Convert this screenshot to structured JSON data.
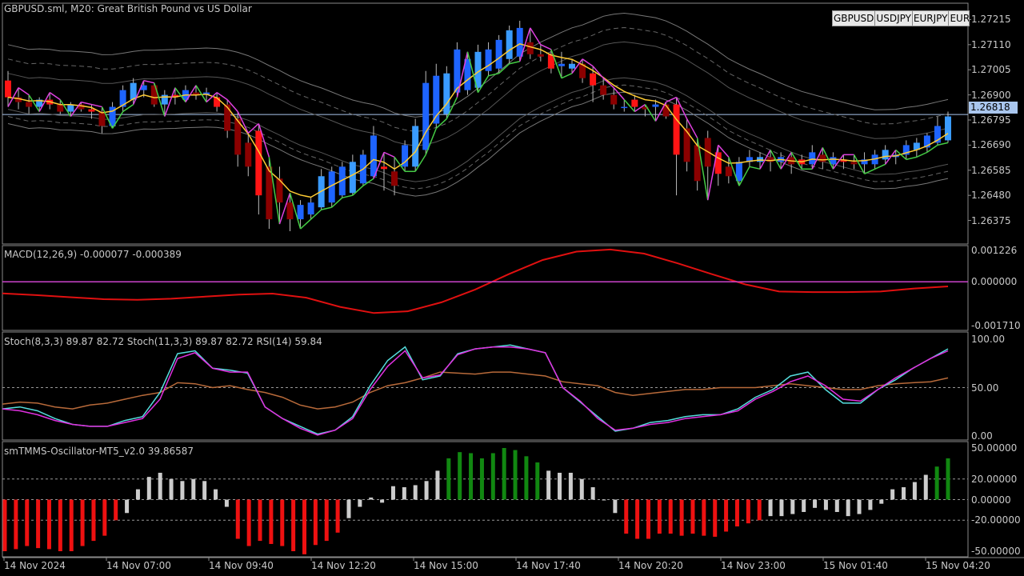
{
  "title": "GBPUSD.sml, M20:  Great British Pound vs US Dollar",
  "symbol_tabs": [
    "GBPUSD",
    "USDJPY",
    "EURJPY",
    "EUR"
  ],
  "current_price": "1.26818",
  "colors": {
    "background": "#000000",
    "bull_candle": "#1e64ff",
    "bull_candle_light": "#3a9bff",
    "bear_candle": "#8b0000",
    "bear_candle_bright": "#ff1414",
    "ma_yellow": "#ffcc33",
    "trail_green": "#44cc44",
    "trail_magenta": "#e040e0",
    "macd_line": "#e01010",
    "macd_signal": "#cc44cc",
    "stoch_cyan": "#55dddd",
    "stoch_magenta": "#e030e0",
    "rsi_brown": "#b86a3a",
    "osc_red": "#ee1111",
    "osc_gray": "#cccccc",
    "osc_green": "#118811"
  },
  "price_axis_labels": [
    "1.27215",
    "1.27110",
    "1.27005",
    "1.26900",
    "1.26795",
    "1.26690",
    "1.26585",
    "1.26480",
    "1.26375"
  ],
  "macd": {
    "label": "MACD(12,26,9) -0.000077 -0.000389",
    "axis_labels": [
      "0.001226",
      "0.000000",
      "-0.001710"
    ]
  },
  "stoch": {
    "label": "Stoch(8,3,3) 89.87 82.72 Stoch(11,3,3) 89.87 82.72 RSI(14) 59.84",
    "axis_labels": [
      "100.00",
      "50.00",
      "0.00"
    ]
  },
  "oscillator": {
    "label": "smTMMS-Oscillator-MT5_v2.0 39.86587",
    "axis_labels": [
      "50.00000",
      "20.00000",
      "0.00000",
      "-20.00000",
      "-50.00000"
    ]
  },
  "time_labels": [
    "14 Nov 2024",
    "14 Nov 07:00",
    "14 Nov 09:40",
    "14 Nov 12:20",
    "14 Nov 15:00",
    "14 Nov 17:40",
    "14 Nov 20:20",
    "14 Nov 23:00",
    "15 Nov 01:40",
    "15 Nov 04:20"
  ],
  "chart_data": {
    "type": "candlestick",
    "price_range": [
      1.263,
      1.2727
    ],
    "candles": [
      [
        1.2696,
        1.27,
        1.2685,
        1.2689
      ],
      [
        1.2689,
        1.2693,
        1.2684,
        1.2687
      ],
      [
        1.2687,
        1.269,
        1.2682,
        1.2685
      ],
      [
        1.2685,
        1.2689,
        1.2683,
        1.2688
      ],
      [
        1.2688,
        1.2691,
        1.2684,
        1.2686
      ],
      [
        1.2686,
        1.2688,
        1.2682,
        1.2683
      ],
      [
        1.2683,
        1.2687,
        1.2681,
        1.2686
      ],
      [
        1.2686,
        1.2687,
        1.2683,
        1.2684
      ],
      [
        1.2684,
        1.2686,
        1.268,
        1.2683
      ],
      [
        1.2683,
        1.2685,
        1.2674,
        1.2677
      ],
      [
        1.2677,
        1.2687,
        1.2676,
        1.2685
      ],
      [
        1.2685,
        1.2694,
        1.2683,
        1.2692
      ],
      [
        1.2688,
        1.2697,
        1.2686,
        1.2695
      ],
      [
        1.2692,
        1.2696,
        1.2689,
        1.2694
      ],
      [
        1.2694,
        1.2695,
        1.2685,
        1.2686
      ],
      [
        1.2686,
        1.2692,
        1.2681,
        1.269
      ],
      [
        1.269,
        1.2693,
        1.2686,
        1.2689
      ],
      [
        1.2688,
        1.2694,
        1.2687,
        1.2692
      ],
      [
        1.2691,
        1.2694,
        1.2688,
        1.269
      ],
      [
        1.269,
        1.2693,
        1.2687,
        1.2691
      ],
      [
        1.2689,
        1.2691,
        1.2683,
        1.2685
      ],
      [
        1.2686,
        1.2688,
        1.2672,
        1.2675
      ],
      [
        1.268,
        1.2683,
        1.266,
        1.2665
      ],
      [
        1.267,
        1.2674,
        1.2656,
        1.266
      ],
      [
        1.2675,
        1.2678,
        1.264,
        1.2648
      ],
      [
        1.266,
        1.2664,
        1.2634,
        1.2638
      ],
      [
        1.2655,
        1.266,
        1.2636,
        1.2645
      ],
      [
        1.2645,
        1.2649,
        1.2633,
        1.2638
      ],
      [
        1.2638,
        1.2646,
        1.2634,
        1.2644
      ],
      [
        1.264,
        1.2647,
        1.2638,
        1.2645
      ],
      [
        1.2643,
        1.2659,
        1.2642,
        1.2656
      ],
      [
        1.2645,
        1.266,
        1.2643,
        1.2658
      ],
      [
        1.2648,
        1.2662,
        1.2647,
        1.266
      ],
      [
        1.2649,
        1.2665,
        1.2648,
        1.2662
      ],
      [
        1.2653,
        1.2667,
        1.2652,
        1.2665
      ],
      [
        1.2656,
        1.2677,
        1.2655,
        1.2673
      ],
      [
        1.266,
        1.2666,
        1.265,
        1.2659
      ],
      [
        1.2658,
        1.2664,
        1.2648,
        1.2652
      ],
      [
        1.266,
        1.2671,
        1.2658,
        1.2669
      ],
      [
        1.266,
        1.268,
        1.2658,
        1.2677
      ],
      [
        1.2667,
        1.27,
        1.2665,
        1.2695
      ],
      [
        1.2678,
        1.2703,
        1.2676,
        1.2698
      ],
      [
        1.2682,
        1.2702,
        1.268,
        1.2699
      ],
      [
        1.2691,
        1.2712,
        1.2689,
        1.2709
      ],
      [
        1.2692,
        1.2708,
        1.269,
        1.2705
      ],
      [
        1.2693,
        1.2711,
        1.2691,
        1.2708
      ],
      [
        1.27,
        1.2712,
        1.2698,
        1.2709
      ],
      [
        1.2701,
        1.2715,
        1.2699,
        1.2713
      ],
      [
        1.2705,
        1.2719,
        1.2703,
        1.2717
      ],
      [
        1.2706,
        1.2721,
        1.2704,
        1.2718
      ],
      [
        1.2712,
        1.2718,
        1.2705,
        1.2707
      ],
      [
        1.2707,
        1.2711,
        1.2704,
        1.2706
      ],
      [
        1.2707,
        1.2709,
        1.2699,
        1.2701
      ],
      [
        1.2702,
        1.2708,
        1.2697,
        1.2703
      ],
      [
        1.2701,
        1.2705,
        1.2699,
        1.2703
      ],
      [
        1.2703,
        1.2705,
        1.2695,
        1.2697
      ],
      [
        1.2699,
        1.2702,
        1.2687,
        1.2694
      ],
      [
        1.2694,
        1.2697,
        1.2688,
        1.269
      ],
      [
        1.269,
        1.2693,
        1.2684,
        1.2686
      ],
      [
        1.2685,
        1.2688,
        1.2683,
        1.2685
      ],
      [
        1.2688,
        1.269,
        1.2683,
        1.2685
      ],
      [
        1.2685,
        1.2686,
        1.2681,
        1.2684
      ],
      [
        1.2685,
        1.2688,
        1.2679,
        1.2686
      ],
      [
        1.2686,
        1.2687,
        1.268,
        1.2681
      ],
      [
        1.2686,
        1.2689,
        1.2648,
        1.2665
      ],
      [
        1.2676,
        1.268,
        1.2658,
        1.2662
      ],
      [
        1.2669,
        1.2672,
        1.265,
        1.2654
      ],
      [
        1.2672,
        1.2675,
        1.2646,
        1.266
      ],
      [
        1.2666,
        1.2669,
        1.2652,
        1.2657
      ],
      [
        1.266,
        1.2664,
        1.2653,
        1.2656
      ],
      [
        1.2654,
        1.2664,
        1.2652,
        1.2662
      ],
      [
        1.2662,
        1.2667,
        1.266,
        1.2664
      ],
      [
        1.2662,
        1.2666,
        1.2659,
        1.2664
      ],
      [
        1.2664,
        1.2667,
        1.2658,
        1.2662
      ],
      [
        1.2662,
        1.2666,
        1.2659,
        1.2664
      ],
      [
        1.2664,
        1.2666,
        1.2657,
        1.2661
      ],
      [
        1.2663,
        1.2665,
        1.2659,
        1.2661
      ],
      [
        1.2661,
        1.2669,
        1.2659,
        1.2666
      ],
      [
        1.2665,
        1.2668,
        1.2659,
        1.2662
      ],
      [
        1.2661,
        1.2666,
        1.2659,
        1.2664
      ],
      [
        1.2663,
        1.2665,
        1.2659,
        1.2662
      ],
      [
        1.2662,
        1.2665,
        1.2659,
        1.2661
      ],
      [
        1.2661,
        1.2666,
        1.2657,
        1.2663
      ],
      [
        1.2661,
        1.2667,
        1.2659,
        1.2665
      ],
      [
        1.2663,
        1.2669,
        1.2661,
        1.2667
      ],
      [
        1.2664,
        1.2667,
        1.2661,
        1.2665
      ],
      [
        1.2665,
        1.2671,
        1.2663,
        1.2669
      ],
      [
        1.2667,
        1.2672,
        1.2664,
        1.267
      ],
      [
        1.2668,
        1.2674,
        1.2666,
        1.2673
      ],
      [
        1.267,
        1.2681,
        1.2669,
        1.2677
      ],
      [
        1.2671,
        1.2683,
        1.267,
        1.2681
      ]
    ],
    "macd_values": [
      -0.00045,
      -0.00052,
      -0.0006,
      -0.00068,
      -0.0007,
      -0.00066,
      -0.00058,
      -0.0005,
      -0.00046,
      -0.00062,
      -0.00098,
      -0.00122,
      -0.00115,
      -0.0008,
      -0.0003,
      0.0003,
      0.00085,
      0.00118,
      0.00126,
      0.0011,
      0.00072,
      0.0003,
      -0.0001,
      -0.00038,
      -0.0004,
      -0.0004,
      -0.00038,
      -0.00026,
      -0.00018
    ],
    "macd_signal": 0.0,
    "stoch_fast": [
      28,
      30,
      26,
      18,
      12,
      10,
      10,
      16,
      20,
      45,
      85,
      88,
      70,
      68,
      65,
      30,
      18,
      10,
      2,
      6,
      20,
      52,
      78,
      92,
      58,
      62,
      85,
      90,
      92,
      94,
      90,
      86,
      50,
      35,
      20,
      5,
      8,
      14,
      16,
      20,
      22,
      22,
      28,
      40,
      48,
      62,
      66,
      48,
      34,
      34,
      48,
      58,
      70,
      80,
      90
    ],
    "stoch_slow": [
      28,
      26,
      22,
      16,
      12,
      10,
      10,
      14,
      18,
      38,
      80,
      86,
      70,
      66,
      66,
      30,
      18,
      8,
      1,
      6,
      18,
      48,
      72,
      88,
      60,
      63,
      84,
      90,
      92,
      92,
      90,
      86,
      50,
      36,
      18,
      6,
      8,
      12,
      14,
      18,
      20,
      22,
      26,
      38,
      46,
      56,
      62,
      52,
      38,
      36,
      48,
      60,
      70,
      80,
      88
    ],
    "rsi": [
      33,
      35,
      34,
      30,
      28,
      32,
      34,
      38,
      42,
      45,
      55,
      54,
      50,
      52,
      48,
      45,
      40,
      32,
      28,
      30,
      35,
      45,
      52,
      55,
      60,
      66,
      65,
      64,
      66,
      66,
      64,
      62,
      56,
      54,
      52,
      45,
      42,
      44,
      46,
      48,
      48,
      50,
      50,
      50,
      52,
      54,
      52,
      50,
      48,
      48,
      52,
      54,
      55,
      56,
      60
    ],
    "oscillator": [
      -50,
      -48,
      -45,
      -47,
      -48,
      -50,
      -50,
      -45,
      -40,
      -35,
      -20,
      -13,
      10,
      22,
      26,
      20,
      18,
      20,
      18,
      10,
      -7,
      -38,
      -45,
      -40,
      -43,
      -45,
      -50,
      -53,
      -44,
      -40,
      -32,
      -18,
      -7,
      2,
      -3,
      13,
      12,
      14,
      18,
      28,
      40,
      46,
      45,
      40,
      45,
      50,
      48,
      42,
      36,
      28,
      26,
      26,
      20,
      12,
      0,
      -13,
      -33,
      -38,
      -38,
      -33,
      -33,
      -35,
      -33,
      -35,
      -36,
      -31,
      -26,
      -23,
      -20,
      -16,
      -16,
      -14,
      -12,
      -8,
      -10,
      -12,
      -16,
      -14,
      -10,
      -4,
      10,
      12,
      17,
      24,
      32,
      40
    ],
    "time_labels": [
      "14 Nov 2024",
      "14 Nov 07:00",
      "14 Nov 09:40",
      "14 Nov 12:20",
      "14 Nov 15:00",
      "14 Nov 17:40",
      "14 Nov 20:20",
      "14 Nov 23:00",
      "15 Nov 01:40",
      "15 Nov 04:20"
    ]
  }
}
